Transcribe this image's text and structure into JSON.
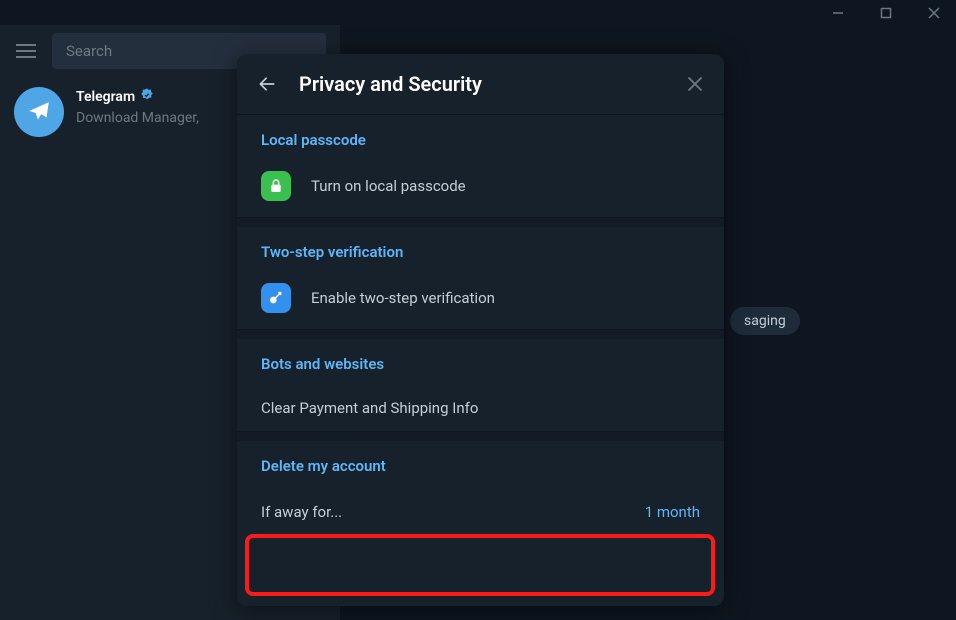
{
  "titlebar": {},
  "sidebar": {
    "search_placeholder": "Search",
    "chat": {
      "name": "Telegram",
      "preview": "Download Manager,"
    }
  },
  "content": {
    "pill": "saging"
  },
  "modal": {
    "title": "Privacy and Security",
    "sections": {
      "local_passcode": {
        "header": "Local passcode",
        "item": "Turn on local passcode"
      },
      "two_step": {
        "header": "Two-step verification",
        "item": "Enable two-step verification"
      },
      "bots": {
        "header": "Bots and websites",
        "item": "Clear Payment and Shipping Info"
      },
      "delete": {
        "header": "Delete my account",
        "label": "If away for...",
        "value": "1 month"
      }
    }
  }
}
